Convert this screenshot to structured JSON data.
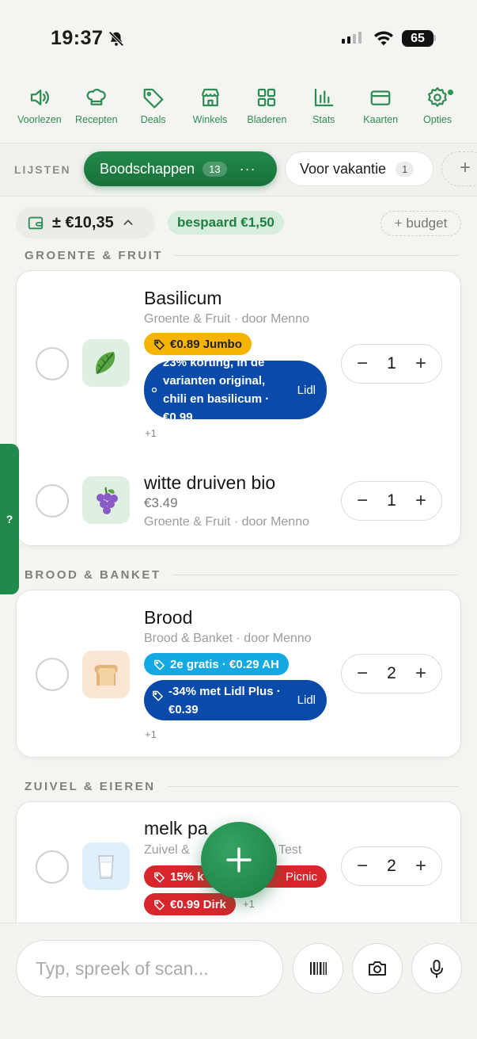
{
  "status": {
    "time": "19:37",
    "battery": "65"
  },
  "toolbar": [
    {
      "label": "Voorlezen",
      "icon": "speaker-icon"
    },
    {
      "label": "Recepten",
      "icon": "chef-hat-icon"
    },
    {
      "label": "Deals",
      "icon": "tag-icon"
    },
    {
      "label": "Winkels",
      "icon": "store-icon"
    },
    {
      "label": "Bladeren",
      "icon": "grid-icon"
    },
    {
      "label": "Stats",
      "icon": "bar-chart-icon"
    },
    {
      "label": "Kaarten",
      "icon": "card-icon"
    },
    {
      "label": "Opties",
      "icon": "gear-icon"
    }
  ],
  "lists": {
    "label": "LIJSTEN",
    "active": {
      "name": "Boodschappen",
      "count": "13",
      "more": "···"
    },
    "other": {
      "name": "Voor vakantie",
      "count": "1"
    },
    "add": "+"
  },
  "budget": {
    "amount": "± €10,35",
    "chevron": "^",
    "saved": "bespaard €1,50",
    "add_budget": "+ budget"
  },
  "help_tab": "?",
  "sections": [
    {
      "title": "GROENTE & FRUIT",
      "items": [
        {
          "name": "Basilicum",
          "meta": "Groente & Fruit · door Menno",
          "tag1": "€0.89 Jumbo",
          "tag2_text": "23% korting, in de varianten original, chili en basilicum · €0.99",
          "tag2_store": "Lidl",
          "more": "+1",
          "qty": "1"
        },
        {
          "name": "witte druiven bio",
          "price": "€3.49",
          "meta": "Groente & Fruit · door Menno",
          "qty": "1"
        }
      ]
    },
    {
      "title": "BROOD & BANKET",
      "items": [
        {
          "name": "Brood",
          "meta": "Brood & Banket · door Menno",
          "tag1": "2e gratis · €0.29 AH",
          "tag2_text": "-34% met Lidl Plus · €0.39",
          "tag2_store": "Lidl",
          "more": "+1",
          "qty": "2"
        }
      ]
    },
    {
      "title": "ZUIVEL & EIEREN",
      "items": [
        {
          "name": "melk pa",
          "meta_left": "Zuivel &",
          "meta_right": "Test",
          "tag1": "15% k",
          "tag1_store": "Picnic",
          "tag2": "€0.99 Dirk",
          "more": "+1",
          "qty": "2"
        }
      ]
    }
  ],
  "input": {
    "placeholder": "Typ, spreek of scan..."
  },
  "colors": {
    "accent": "#1f8a4a",
    "lidl": "#0a4aa8",
    "jumbo": "#f6b400",
    "ah": "#14a9e2",
    "red": "#d9252c"
  }
}
